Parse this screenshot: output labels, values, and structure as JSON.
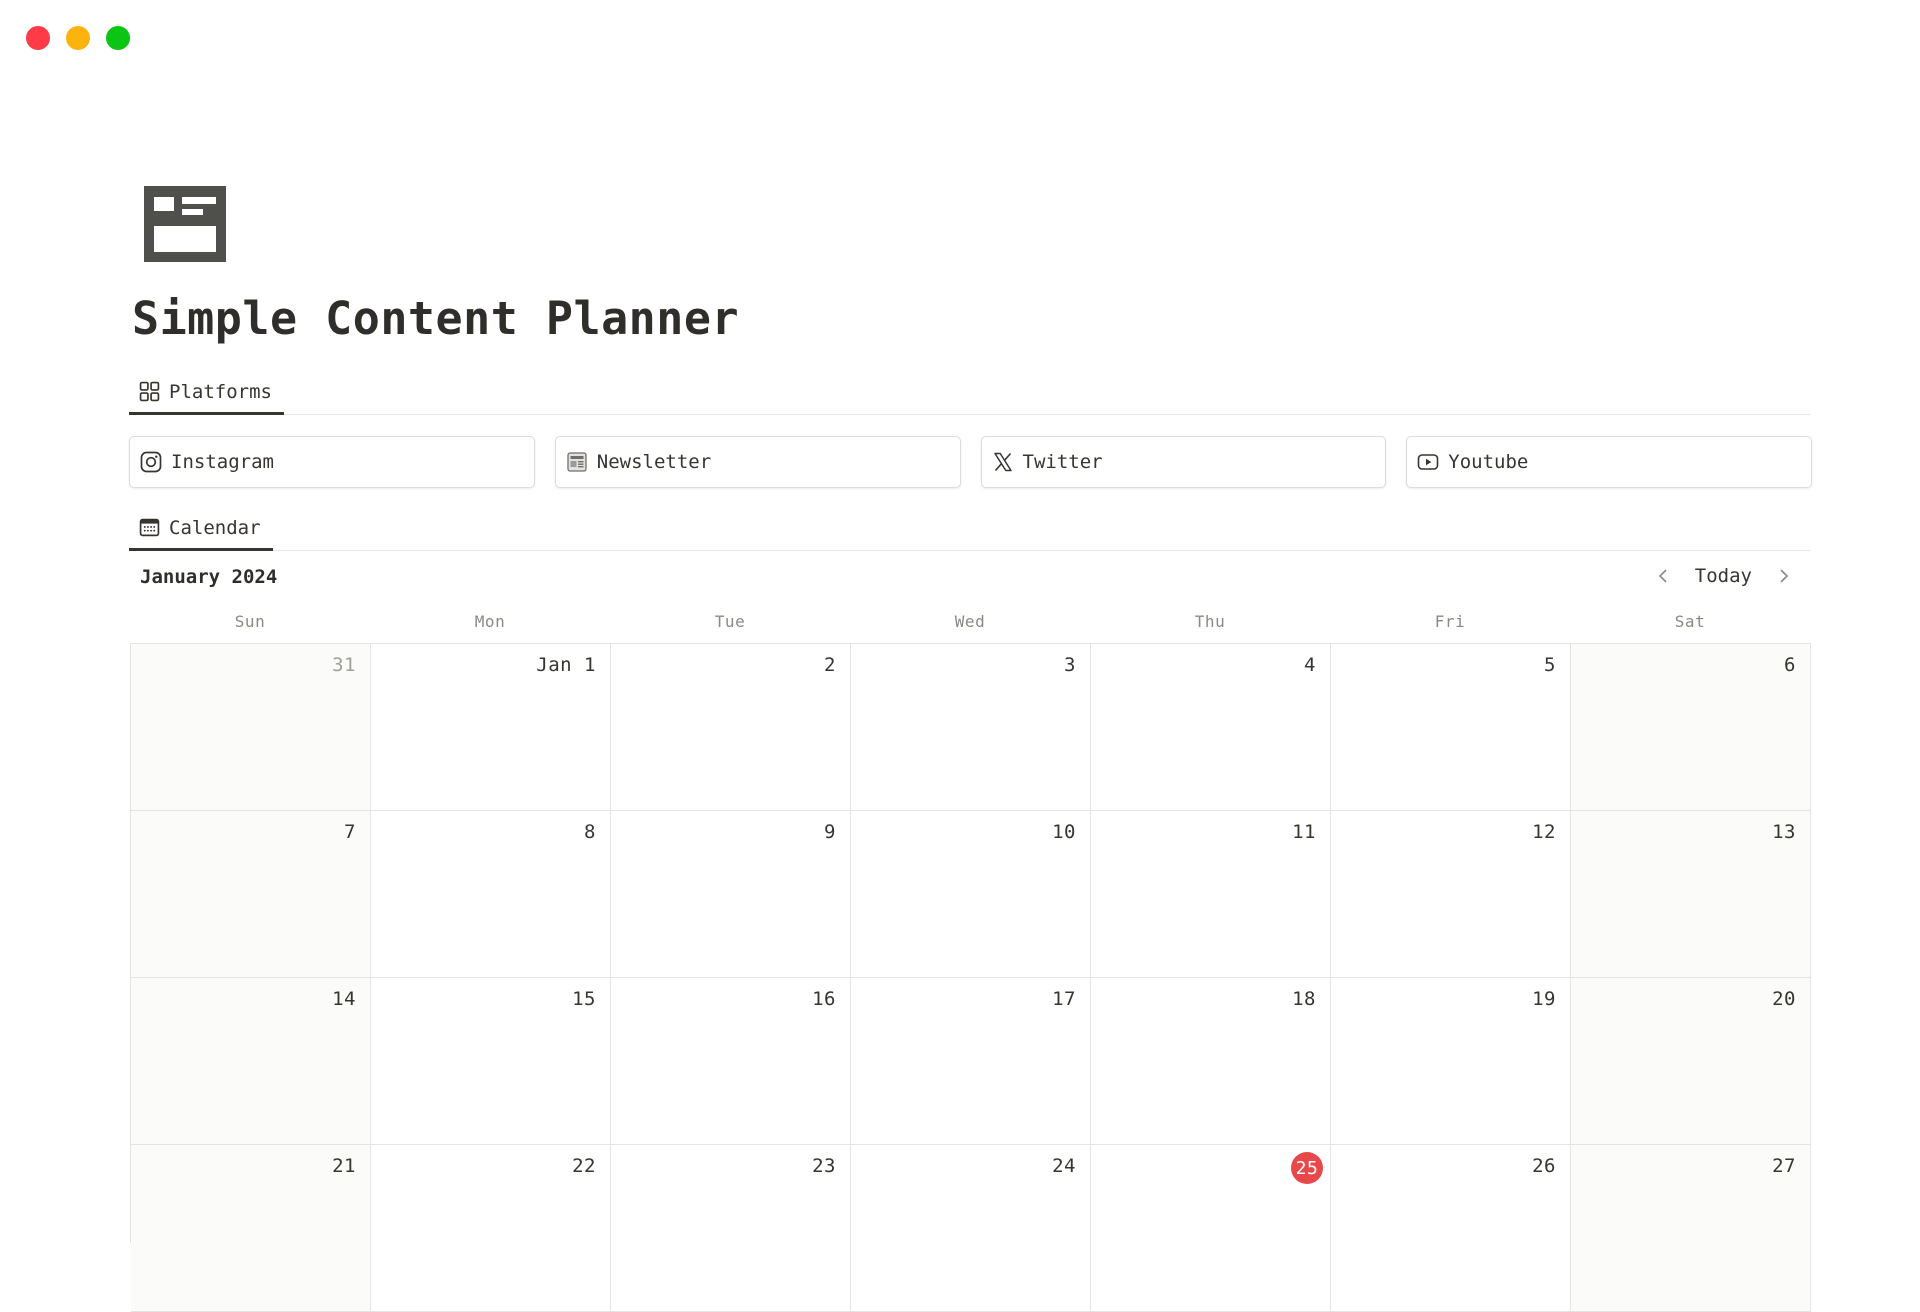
{
  "window": {
    "controls": [
      "close",
      "minimize",
      "maximize"
    ],
    "colors": {
      "close": "#fe3b47",
      "minimize": "#fdb30d",
      "maximize": "#0bc413"
    }
  },
  "page": {
    "icon": "layout-panel-icon",
    "title": "Simple Content Planner"
  },
  "platforms_view": {
    "tab_label": "Platforms",
    "tab_icon": "gallery-grid-icon",
    "cards": [
      {
        "label": "Instagram",
        "icon": "instagram-icon"
      },
      {
        "label": "Newsletter",
        "icon": "newspaper-icon"
      },
      {
        "label": "Twitter",
        "icon": "x-twitter-icon"
      },
      {
        "label": "Youtube",
        "icon": "youtube-icon"
      }
    ]
  },
  "calendar_view": {
    "tab_label": "Calendar",
    "tab_icon": "calendar-icon",
    "month_label": "January 2024",
    "today_label": "Today",
    "weekdays": [
      "Sun",
      "Mon",
      "Tue",
      "Wed",
      "Thu",
      "Fri",
      "Sat"
    ],
    "today_color": "#e9484b",
    "weeks": [
      [
        "31",
        "Jan 1",
        "2",
        "3",
        "4",
        "5",
        "6"
      ],
      [
        "7",
        "8",
        "9",
        "10",
        "11",
        "12",
        "13"
      ],
      [
        "14",
        "15",
        "16",
        "17",
        "18",
        "19",
        "20"
      ],
      [
        "21",
        "22",
        "23",
        "24",
        "25",
        "26",
        "27"
      ]
    ],
    "outside_month_days": [
      "31"
    ],
    "today_day": "25"
  }
}
